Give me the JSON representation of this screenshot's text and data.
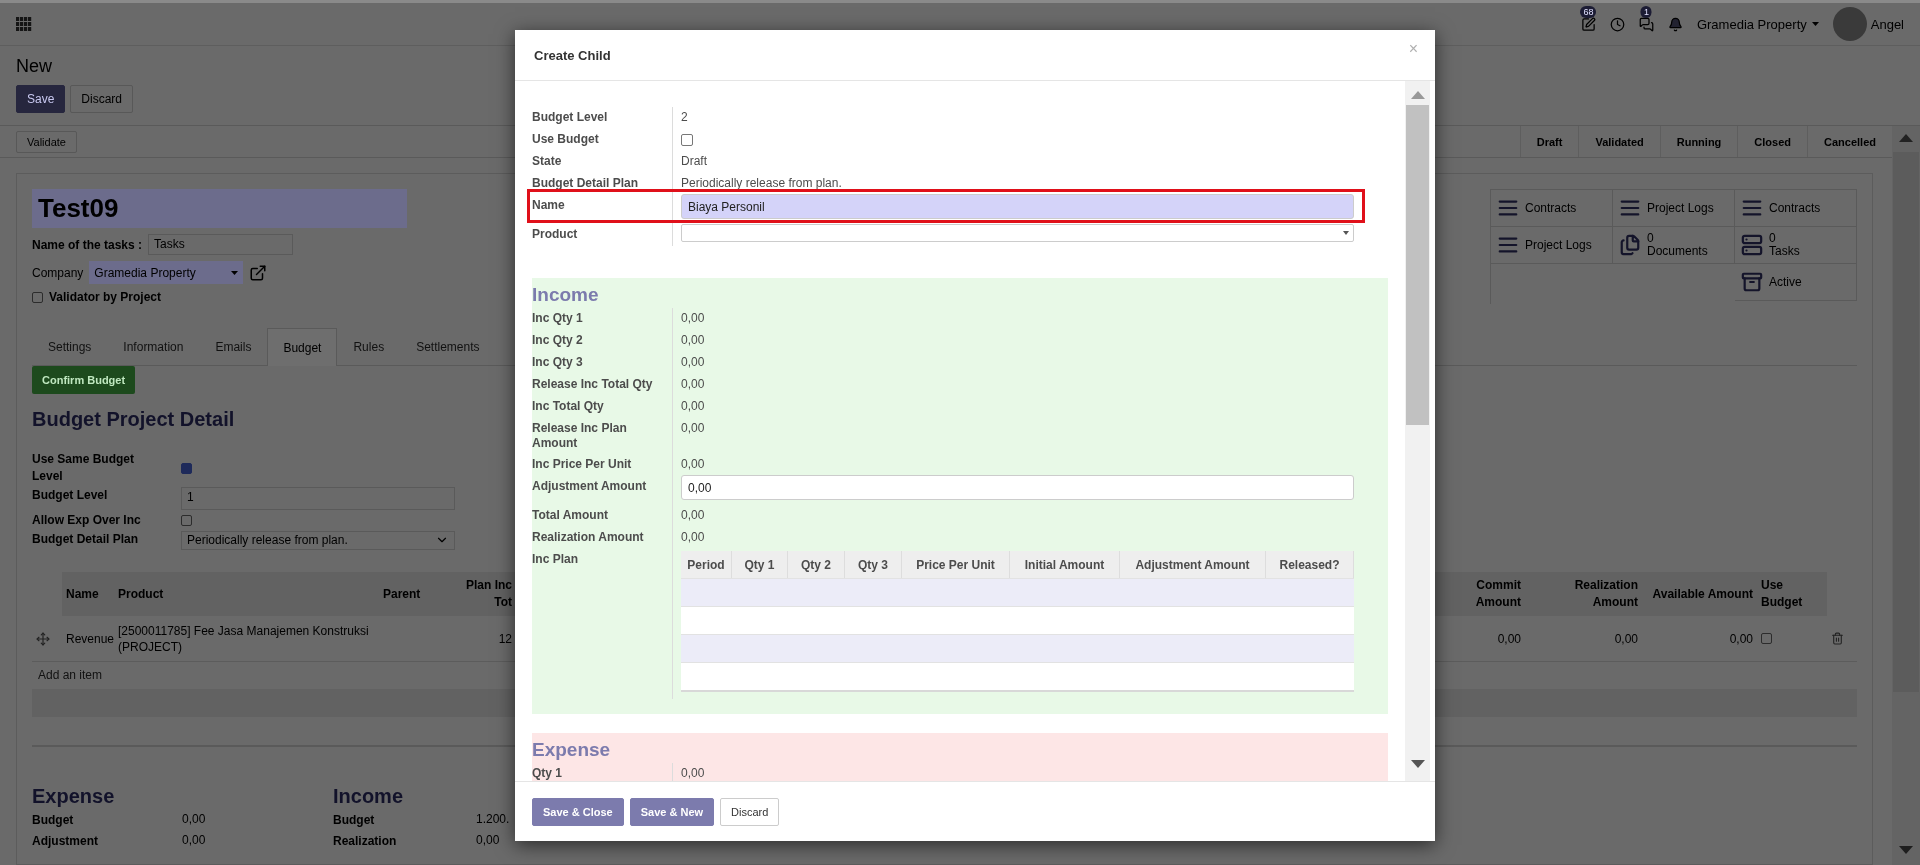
{
  "topbar": {
    "icons": [
      {
        "kind": "edit",
        "badge": "68"
      },
      {
        "kind": "clock"
      },
      {
        "kind": "chat",
        "badge": "1"
      },
      {
        "kind": "bell"
      }
    ],
    "company": "Gramedia Property",
    "user": "Angel"
  },
  "breadcrumb": "New",
  "form_buttons": [
    {
      "label": "Save",
      "kind": "primary"
    },
    {
      "label": "Discard",
      "kind": "secondary"
    }
  ],
  "header_buttons": [
    "Validate"
  ],
  "statusbar": [
    "Draft",
    "Validated",
    "Running",
    "Closed",
    "Cancelled"
  ],
  "sheet": {
    "title": "Test09",
    "tasks": {
      "label": "Name of the tasks :",
      "value": "Tasks"
    },
    "company": {
      "label": "Company",
      "value": "Gramedia Property"
    },
    "validator": {
      "label": "Validator by Project",
      "checked": false
    }
  },
  "smart_buttons": [
    {
      "kind": "list",
      "label": "Contracts"
    },
    {
      "kind": "list",
      "label": "Project Logs"
    },
    {
      "kind": "list",
      "label": "Contracts"
    },
    {
      "kind": "list",
      "label": "Project Logs"
    },
    {
      "kind": "documents",
      "count": "0",
      "label": "Documents"
    },
    {
      "kind": "tasks",
      "count": "0",
      "label": "Tasks"
    },
    {
      "kind": "archive",
      "label": "Active"
    }
  ],
  "tabs": [
    {
      "label": "Settings",
      "selected": false
    },
    {
      "label": "Information",
      "selected": false
    },
    {
      "label": "Emails",
      "selected": false
    },
    {
      "label": "Budget",
      "selected": true
    },
    {
      "label": "Rules",
      "selected": false
    },
    {
      "label": "Settlements",
      "selected": false
    }
  ],
  "confirm_button": "Confirm Budget",
  "section_title": "Budget Project Detail",
  "budget_fields": [
    {
      "label": "Use Same Budget Level",
      "kind": "checkbox",
      "checked": true
    },
    {
      "label": "Budget Level",
      "kind": "input",
      "value": "1"
    },
    {
      "label": "Allow Exp Over Inc",
      "kind": "checkbox",
      "checked": false
    },
    {
      "label": "Budget Detail Plan",
      "kind": "select",
      "value": "Periodically release from plan."
    }
  ],
  "budget_table": {
    "columns_left": [
      "Name",
      "Product",
      "Parent",
      "Plan Inc Tot"
    ],
    "columns_right": [
      "Commit Amount",
      "Realization Amount",
      "Available Amount",
      "Use Budget"
    ],
    "rows": [
      {
        "name": "Revenue",
        "product": "[2500011785] Fee Jasa Manajemen Konstruksi (PROJECT)",
        "plan_inc": "12",
        "commit": "0,00",
        "realization": "0,00",
        "available": "0,00",
        "use_budget": false
      }
    ],
    "add_item": "Add an item"
  },
  "summary": [
    {
      "title": "Expense",
      "rows": [
        {
          "label": "Budget",
          "value": "0,00"
        },
        {
          "label": "Adjustment",
          "value": "0,00"
        }
      ]
    },
    {
      "title": "Income",
      "rows": [
        {
          "label": "Budget",
          "value": "1.200."
        },
        {
          "label": "Realization",
          "value": "0,00"
        }
      ]
    }
  ],
  "dialog": {
    "title": "Create Child",
    "close": "×",
    "fields": [
      {
        "label": "Budget Level",
        "kind": "text",
        "value": "2"
      },
      {
        "label": "Use Budget",
        "kind": "checkbox",
        "checked": false
      },
      {
        "label": "State",
        "kind": "text",
        "value": "Draft"
      },
      {
        "label": "Budget Detail Plan",
        "kind": "text",
        "value": "Periodically release from plan."
      },
      {
        "label": "Name",
        "kind": "input",
        "value": "Biaya Personil",
        "highlighted": true
      },
      {
        "label": "Product",
        "kind": "select"
      }
    ],
    "income": {
      "title": "Income",
      "fields": [
        {
          "label": "Inc Qty 1",
          "kind": "text",
          "value": "0,00"
        },
        {
          "label": "Inc Qty 2",
          "kind": "text",
          "value": "0,00"
        },
        {
          "label": "Inc Qty 3",
          "kind": "text",
          "value": "0,00"
        },
        {
          "label": "Release Inc Total Qty",
          "kind": "text",
          "value": "0,00"
        },
        {
          "label": "Inc Total Qty",
          "kind": "text",
          "value": "0,00"
        },
        {
          "label": "Release Inc Plan Amount",
          "kind": "text",
          "value": "0,00"
        },
        {
          "label": "Inc Price Per Unit",
          "kind": "text",
          "value": "0,00"
        },
        {
          "label": "Adjustment Amount",
          "kind": "input",
          "value": "0,00"
        },
        {
          "label": "Total Amount",
          "kind": "text",
          "value": "0,00"
        },
        {
          "label": "Realization Amount",
          "kind": "text",
          "value": "0,00"
        },
        {
          "label": "Inc Plan",
          "kind": "table",
          "columns": [
            "Period",
            "Qty 1",
            "Qty 2",
            "Qty 3",
            "Price Per Unit",
            "Initial Amount",
            "Adjustment Amount",
            "Released?"
          ]
        }
      ]
    },
    "expense": {
      "title": "Expense",
      "fields": [
        {
          "label": "Qty 1",
          "kind": "text",
          "value": "0,00"
        }
      ]
    },
    "buttons": [
      {
        "label": "Save & Close",
        "kind": "primary"
      },
      {
        "label": "Save & New",
        "kind": "primary"
      },
      {
        "label": "Discard",
        "kind": "secondary"
      }
    ]
  }
}
